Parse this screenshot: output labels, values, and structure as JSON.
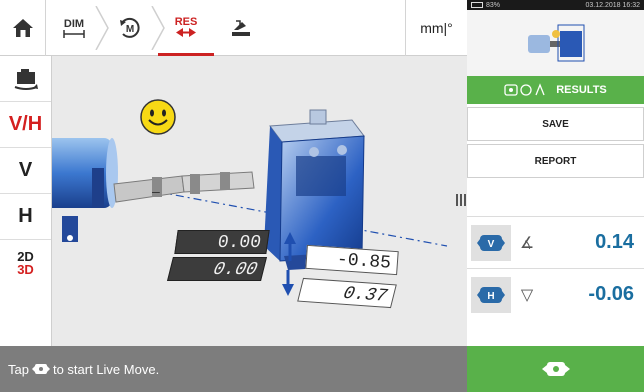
{
  "toolbar": {
    "home_icon": "home-icon",
    "steps": [
      {
        "label": "DIM",
        "icon": "dimensions-icon"
      },
      {
        "label": "",
        "icon": "measure-icon"
      },
      {
        "label": "RES",
        "icon": "results-icon"
      },
      {
        "label": "",
        "icon": "correct-icon"
      }
    ],
    "units": "mm|°"
  },
  "sidebar": {
    "items": [
      {
        "icon": "machine-flip-icon",
        "label": ""
      },
      {
        "label": "V/H"
      },
      {
        "label": "V"
      },
      {
        "label": "H"
      },
      {
        "label_top": "2D",
        "label_bottom": "3D"
      }
    ]
  },
  "viewport": {
    "smiley": "smiley-face-icon",
    "values": {
      "v_left": "0.00",
      "h_left": "0.00",
      "v_right": "-0.85",
      "h_right": "0.37"
    }
  },
  "statusbar": {
    "prefix": "Tap",
    "suffix": "to start Live Move."
  },
  "rpanel": {
    "android": {
      "battery": "83%",
      "datetime": "03.12.2018 16:32"
    },
    "results_label": "RESULTS",
    "save_label": "SAVE",
    "report_label": "REPORT",
    "rows": [
      {
        "icon": "vertical-coupling-icon",
        "symbol": "∡",
        "value": "0.14"
      },
      {
        "icon": "horizontal-coupling-icon",
        "symbol": "▽",
        "value": "-0.06"
      }
    ]
  },
  "colors": {
    "accent_red": "#d42020",
    "accent_green": "#59b14a",
    "value_blue": "#1a6ea0",
    "machine_blue": "#2a5fc0"
  }
}
